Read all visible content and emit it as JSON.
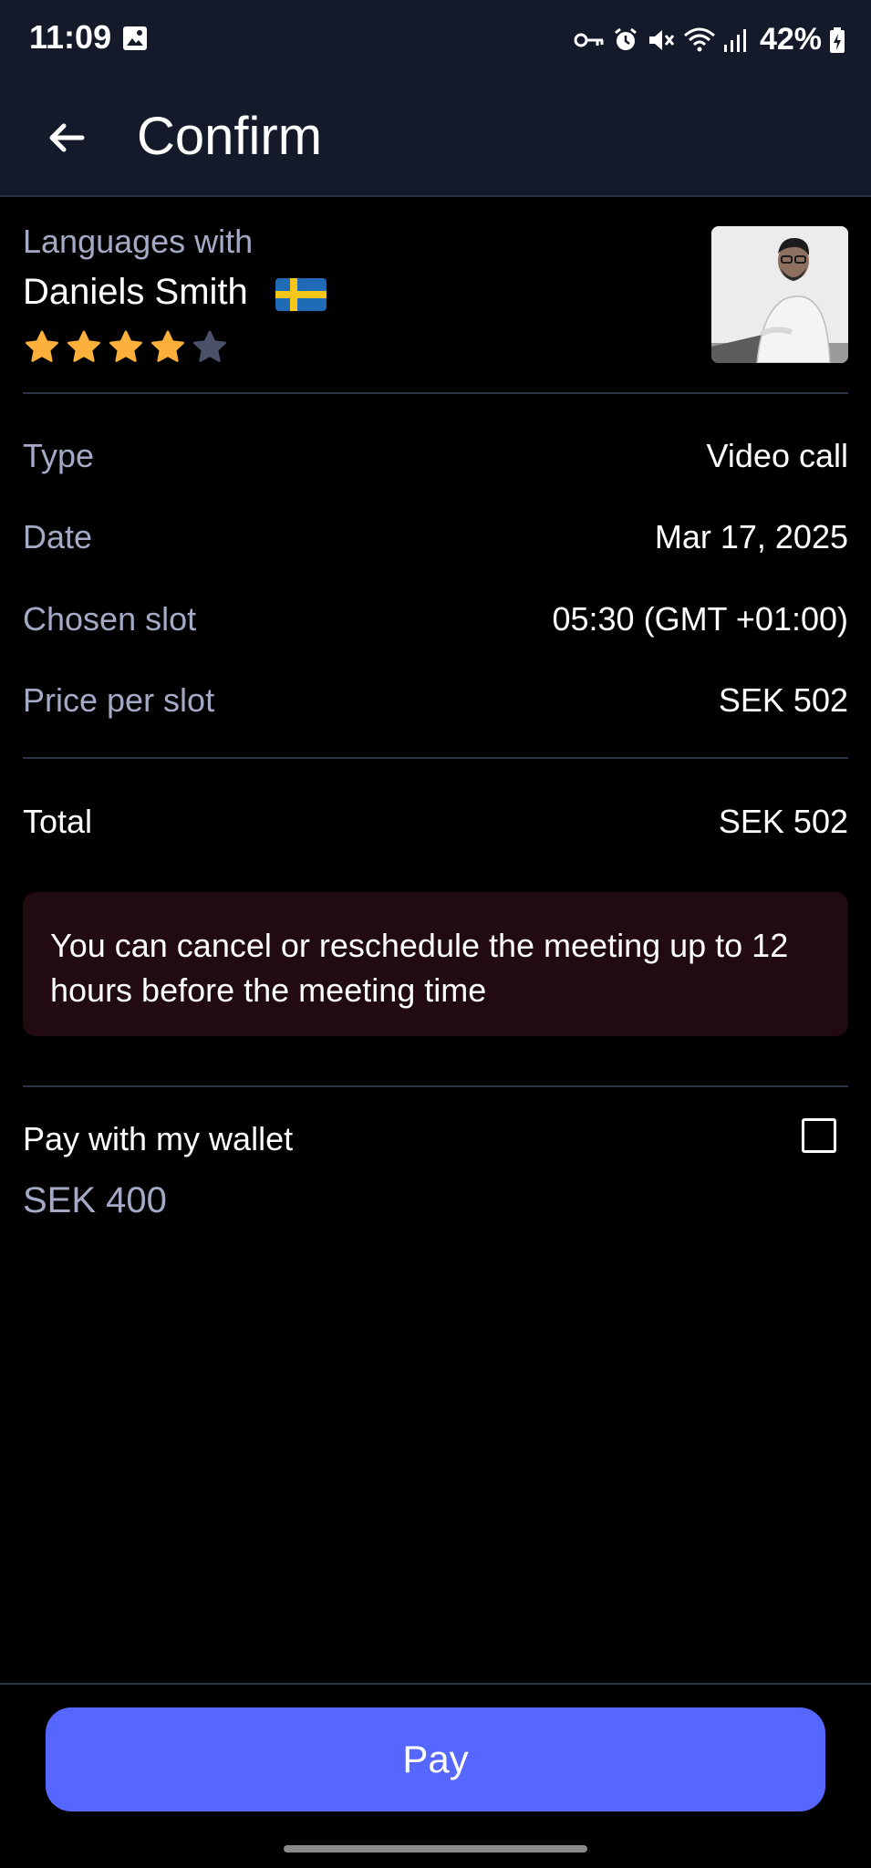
{
  "status_bar": {
    "time": "11:09",
    "battery": "42%",
    "icons": [
      "gallery-icon",
      "vpn-key-icon",
      "alarm-icon",
      "mute-icon",
      "wifi-icon",
      "signal-icon",
      "battery-icon"
    ]
  },
  "app_bar": {
    "title": "Confirm",
    "back_icon": "arrow-left-icon"
  },
  "tutor": {
    "caption": "Languages with",
    "name": "Daniels Smith",
    "flag": "sweden-flag",
    "rating": 4,
    "rating_max": 5
  },
  "details": {
    "type_label": "Type",
    "type_value": "Video call",
    "date_label": "Date",
    "date_value": "Mar 17, 2025",
    "slot_label": "Chosen slot",
    "slot_value": "05:30 (GMT +01:00)",
    "price_label": "Price per slot",
    "price_value": "SEK 502"
  },
  "total": {
    "label": "Total",
    "value": "SEK 502"
  },
  "notice": {
    "text": "You can cancel or reschedule the meeting up to 12 hours before the meeting time"
  },
  "wallet": {
    "label": "Pay with my wallet",
    "amount": "SEK 400",
    "checked": false
  },
  "pay_button": {
    "label": "Pay"
  },
  "colors": {
    "accent": "#5667ff",
    "star": "#fbb03b",
    "star_empty": "#4a5068",
    "notice_bg": "#210b10"
  }
}
